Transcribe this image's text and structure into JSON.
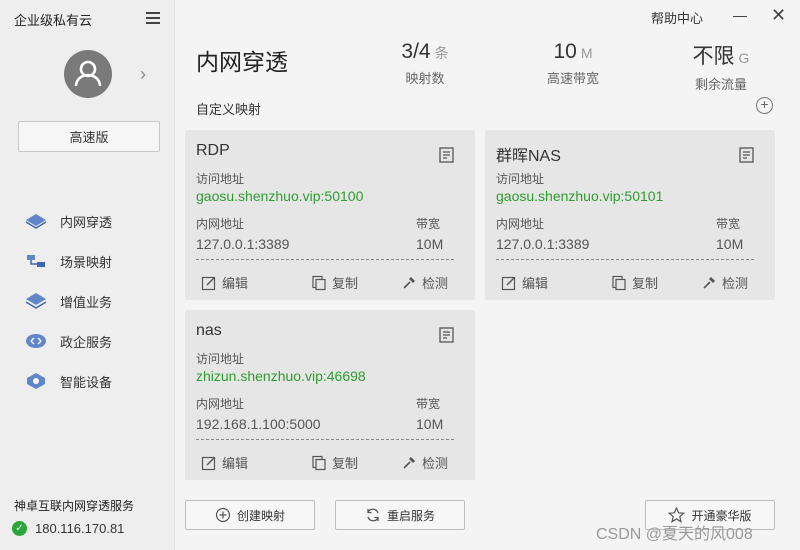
{
  "app": {
    "title": "企业级私有云"
  },
  "sidebar": {
    "plan_label": "高速版",
    "nav": [
      {
        "label": "内网穿透",
        "icon": "network-icon"
      },
      {
        "label": "场景映射",
        "icon": "scene-icon"
      },
      {
        "label": "增值业务",
        "icon": "value-added-icon"
      },
      {
        "label": "政企服务",
        "icon": "enterprise-icon"
      },
      {
        "label": "智能设备",
        "icon": "device-icon"
      }
    ],
    "service_title": "神卓互联内网穿透服务",
    "service_ip": "180.116.170.81",
    "status_color": "#2aa53b"
  },
  "topbar": {
    "help": "帮助中心"
  },
  "main": {
    "title": "内网穿透",
    "stats": [
      {
        "value": "3/4",
        "unit": "条",
        "label": "映射数"
      },
      {
        "value": "10",
        "unit": "M",
        "label": "高速带宽"
      },
      {
        "value": "不限",
        "unit": "G",
        "label": "剩余流量"
      }
    ],
    "section_label": "自定义映射",
    "cards": [
      {
        "name": "RDP",
        "addr_label": "访问地址",
        "addr": "gaosu.shenzhuo.vip:50100",
        "lan_label": "内网地址",
        "lan": "127.0.0.1:3389",
        "bw_label": "带宽",
        "bw": "10M"
      },
      {
        "name": "群晖NAS",
        "addr_label": "访问地址",
        "addr": "gaosu.shenzhuo.vip:50101",
        "lan_label": "内网地址",
        "lan": "127.0.0.1:3389",
        "bw_label": "带宽",
        "bw": "10M"
      },
      {
        "name": "nas",
        "addr_label": "访问地址",
        "addr": "zhizun.shenzhuo.vip:46698",
        "lan_label": "内网地址",
        "lan": "192.168.1.100:5000",
        "bw_label": "带宽",
        "bw": "10M"
      }
    ],
    "actions": {
      "edit": "编辑",
      "copy": "复制",
      "check": "检测"
    },
    "buttons": {
      "create": "创建映射",
      "restart": "重启服务",
      "upgrade": "开通豪华版"
    },
    "link_color": "#2d9e2d"
  },
  "watermark": "CSDN @夏天的风008"
}
